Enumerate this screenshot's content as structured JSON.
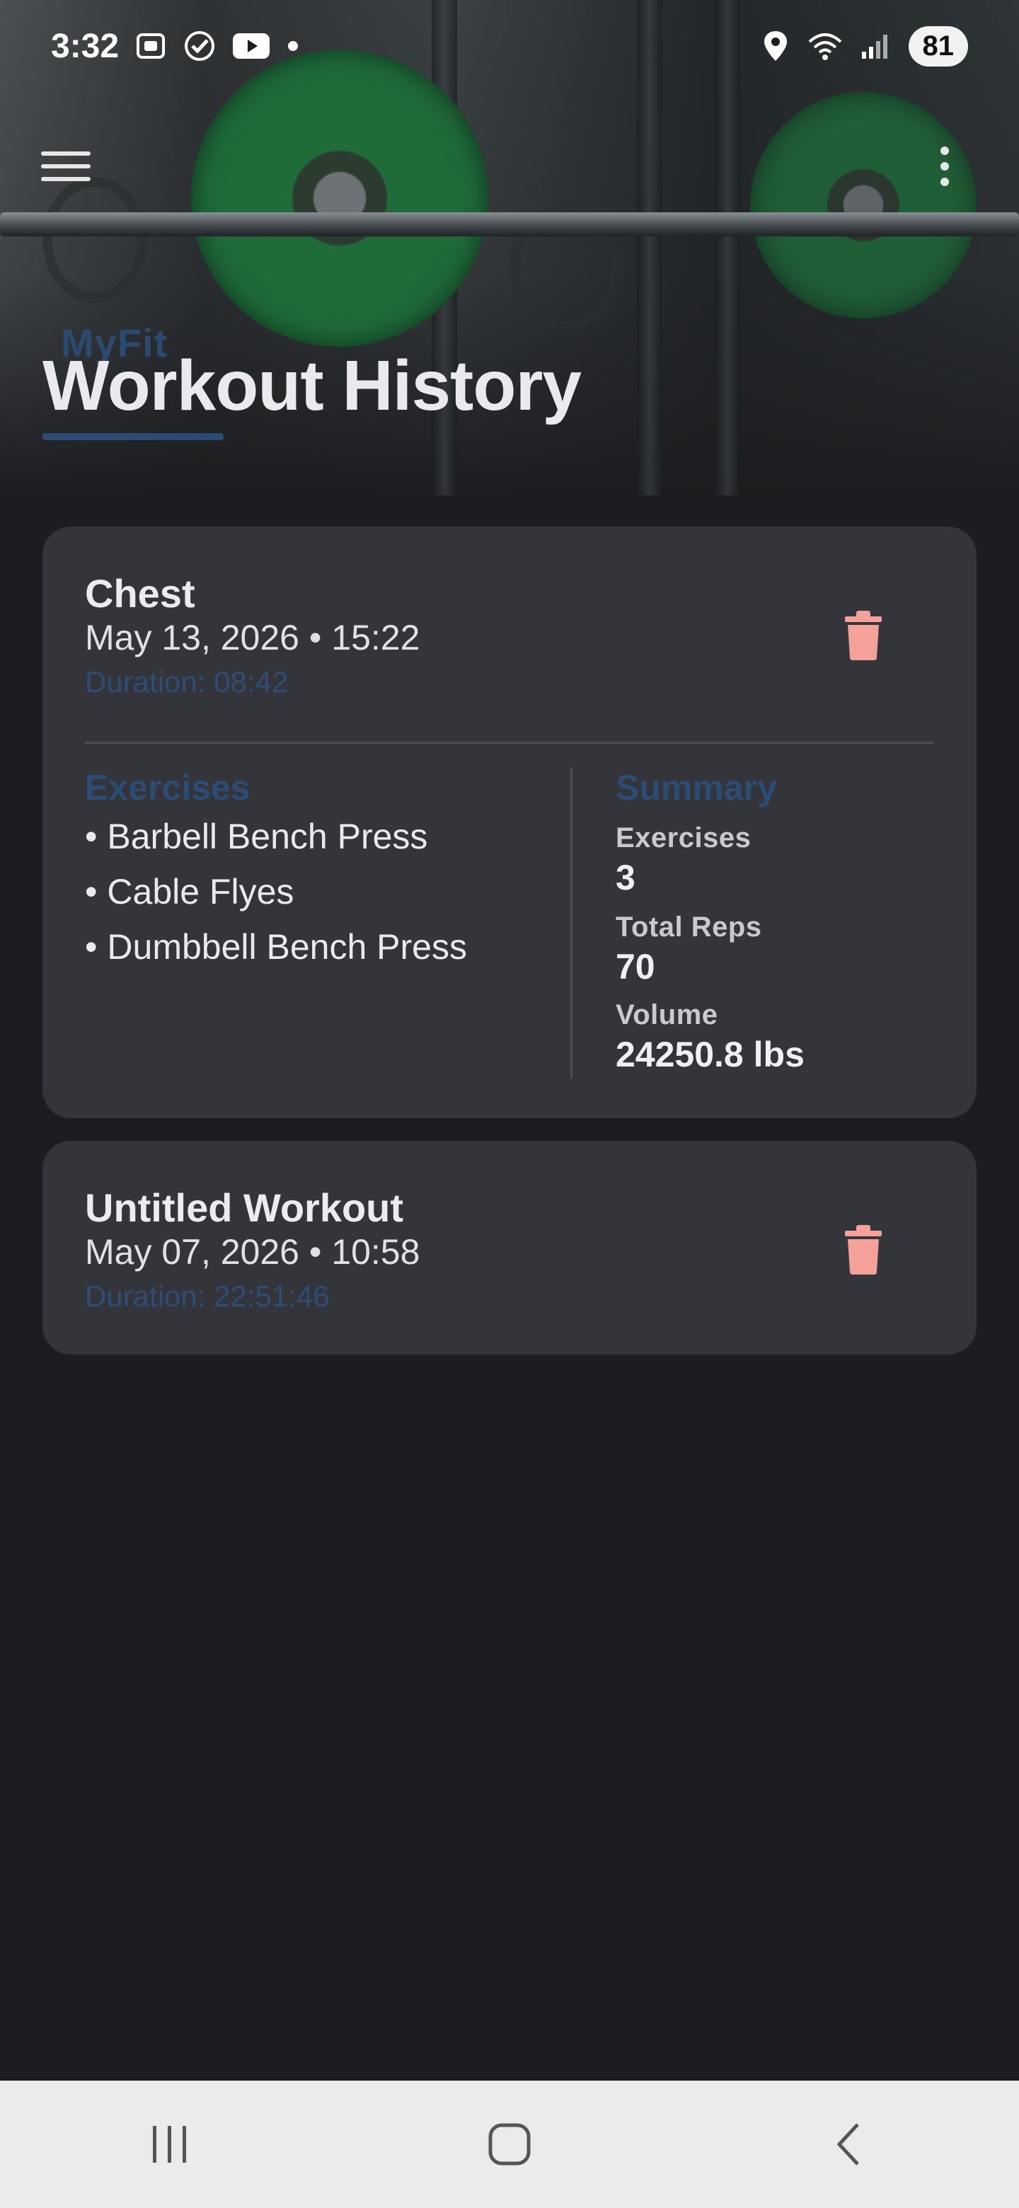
{
  "status_bar": {
    "time": "3:32",
    "battery": "81"
  },
  "app": {
    "brand": "MyFit",
    "title": "Workout History"
  },
  "workouts": [
    {
      "name": "Chest",
      "date": "May 13, 2026 • 15:22",
      "duration": "Duration: 08:42",
      "exercises_title": "Exercises",
      "exercises": [
        "• Barbell Bench Press",
        "• Cable Flyes",
        "• Dumbbell Bench Press"
      ],
      "summary_title": "Summary",
      "summary": [
        {
          "label": "Exercises",
          "value": "3"
        },
        {
          "label": "Total Reps",
          "value": "70"
        },
        {
          "label": "Volume",
          "value": "24250.8 lbs"
        }
      ]
    },
    {
      "name": "Untitled Workout",
      "date": "May 07, 2026 • 10:58",
      "duration": "Duration: 22:51:46"
    }
  ],
  "icons": {
    "menu": "hamburger-menu-icon",
    "more": "more-vertical-icon",
    "delete": "trash-icon",
    "nav_recents": "recents-icon",
    "nav_home": "home-icon",
    "nav_back": "back-icon"
  },
  "colors": {
    "background": "#1c1d20",
    "card": "#34343b",
    "accent_blue": "#2b4c74",
    "delete_red": "#f4a19a",
    "nav_bar": "#ebebeb"
  }
}
